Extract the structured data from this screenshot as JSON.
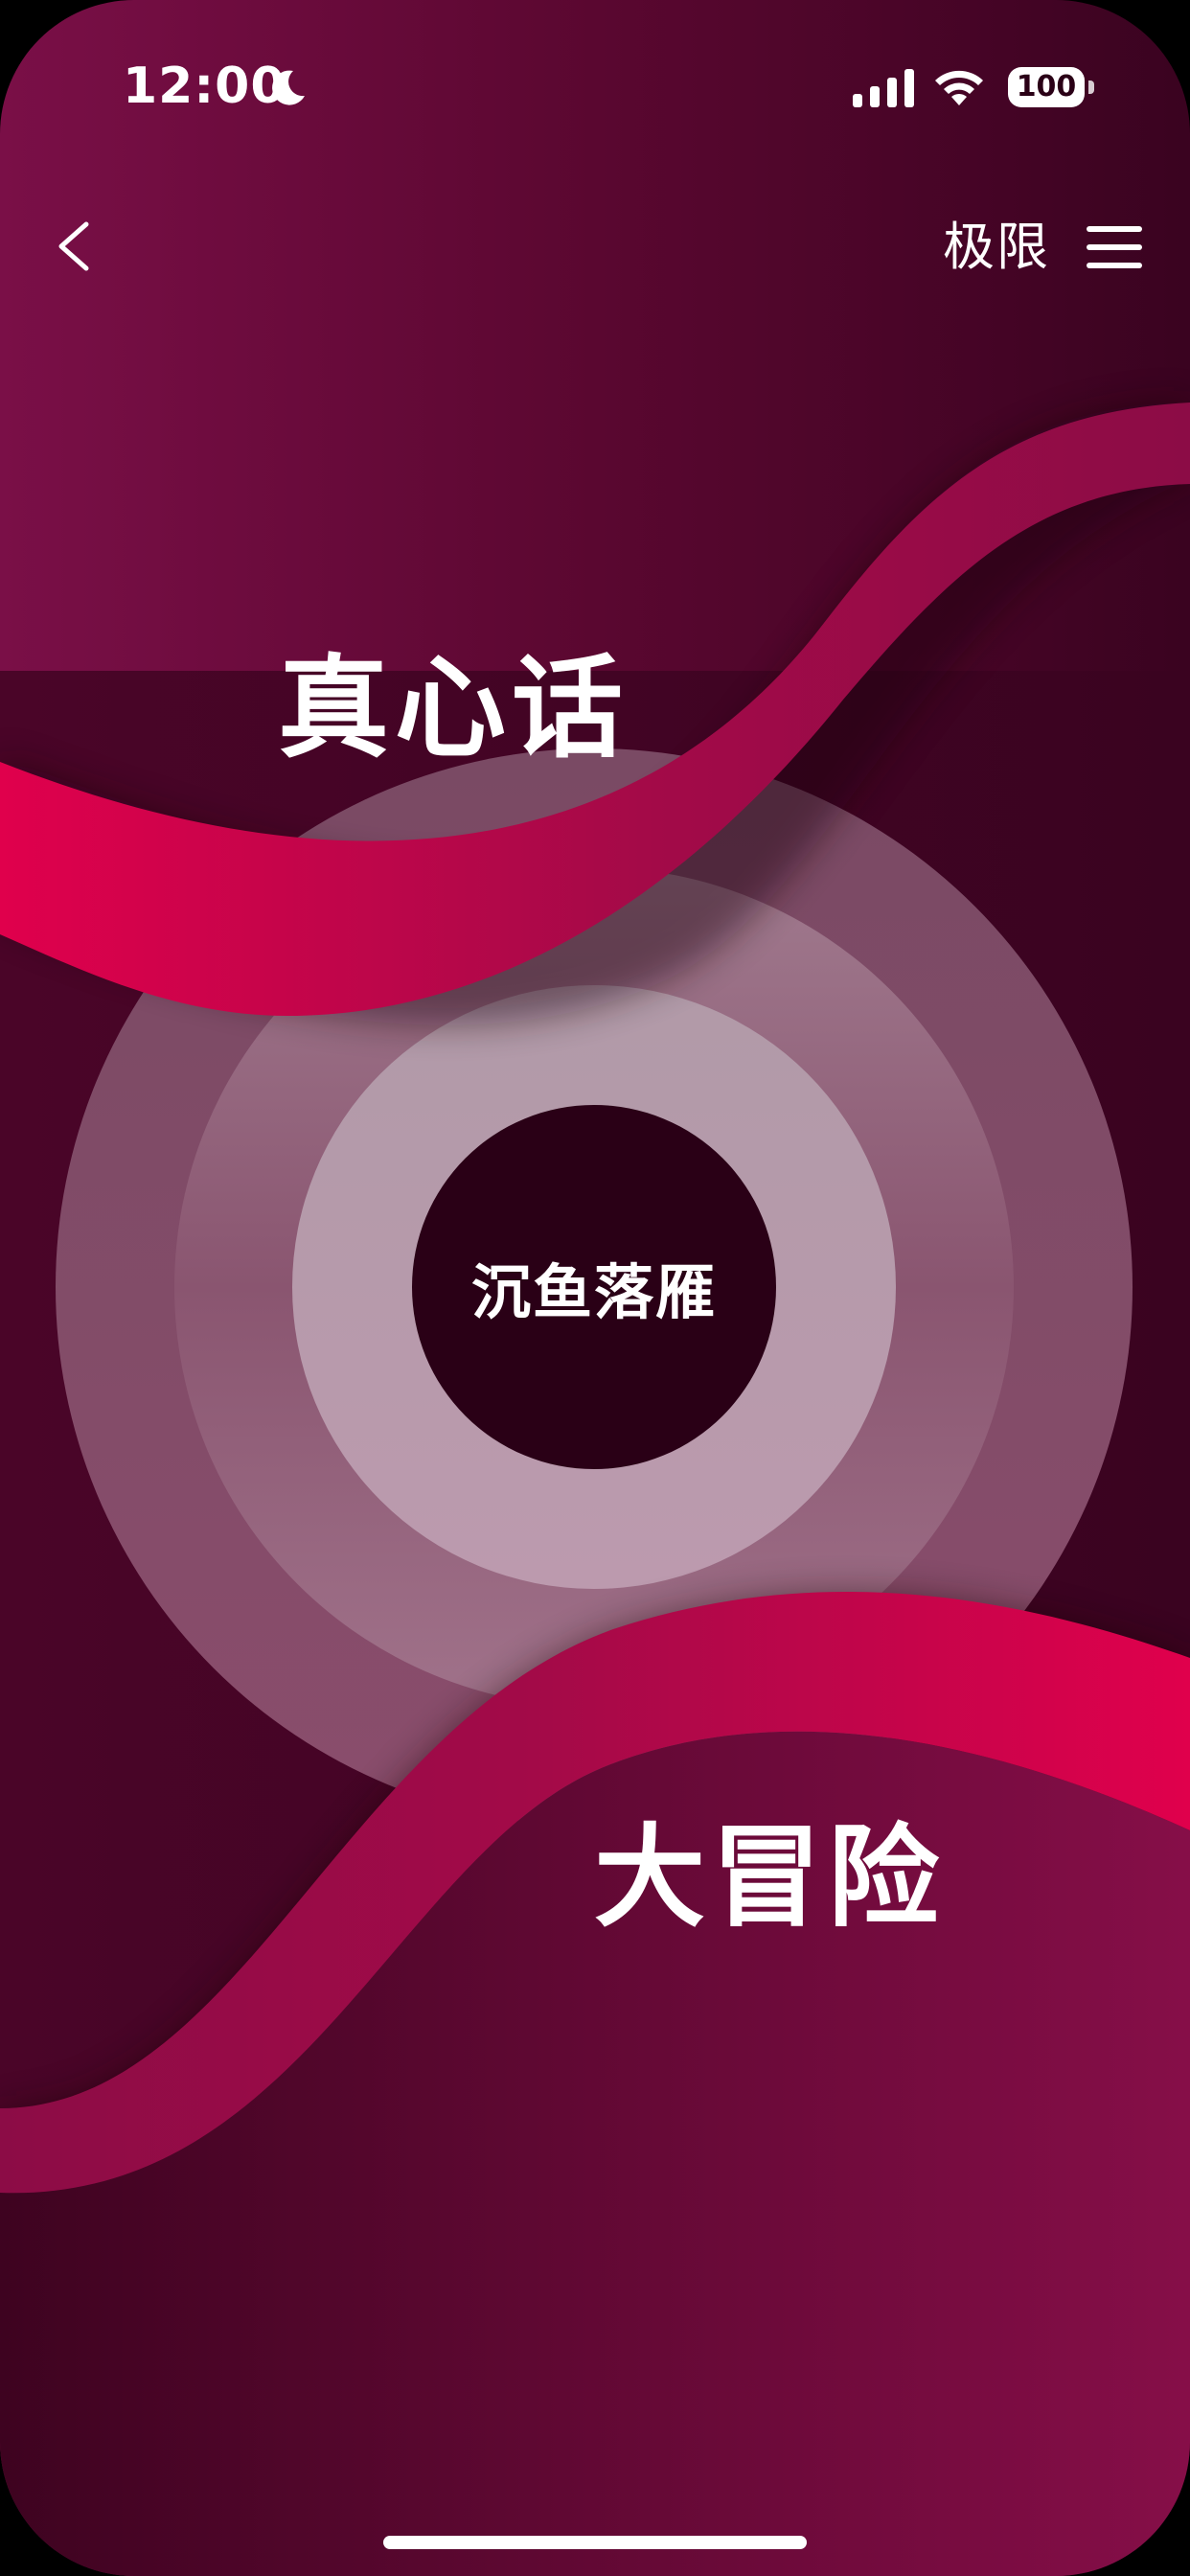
{
  "status_bar": {
    "time": "12:00",
    "battery": "100"
  },
  "nav": {
    "mode_label": "极限"
  },
  "options": {
    "truth": "真心话",
    "dare": "大冒险"
  },
  "spinner": {
    "center_label": "沉鱼落雁"
  },
  "icons": [
    "moon-icon",
    "signal-icon",
    "wifi-icon",
    "back-chevron-icon",
    "menu-icon"
  ],
  "colors": {
    "background_left": "#7a0f47",
    "background_right": "#3a0320",
    "band_accent": "#e0004c",
    "center_disc": "#2a0016"
  }
}
